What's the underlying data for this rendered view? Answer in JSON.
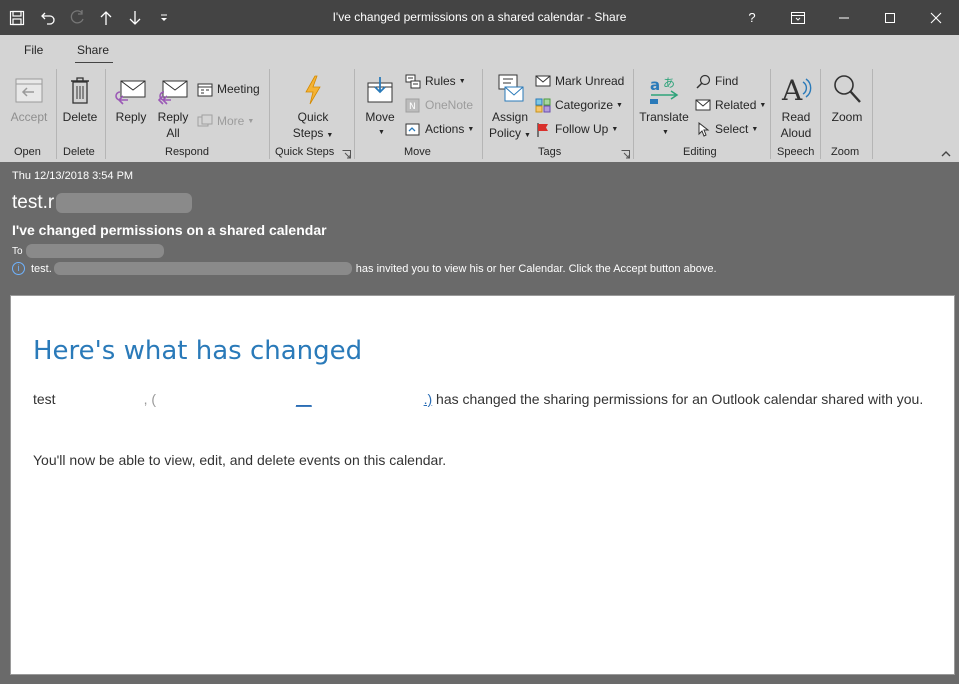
{
  "window": {
    "title": "I've changed permissions on a shared calendar  -  Share",
    "help": "?"
  },
  "tabs": [
    {
      "label": "File"
    },
    {
      "label": "Share"
    }
  ],
  "ribbon": {
    "open": {
      "accept": "Accept",
      "group": "Open"
    },
    "delete": {
      "delete": "Delete",
      "group": "Delete"
    },
    "respond": {
      "reply": "Reply",
      "reply_all_1": "Reply",
      "reply_all_2": "All",
      "meeting": "Meeting",
      "more": "More",
      "group": "Respond"
    },
    "quick_steps": {
      "label_1": "Quick",
      "label_2": "Steps",
      "group": "Quick Steps"
    },
    "move": {
      "move": "Move",
      "rules": "Rules",
      "onenote": "OneNote",
      "actions": "Actions",
      "group": "Move"
    },
    "tags": {
      "assign_1": "Assign",
      "assign_2": "Policy",
      "mark_unread": "Mark Unread",
      "categorize": "Categorize",
      "follow_up": "Follow Up",
      "group": "Tags"
    },
    "editing": {
      "translate": "Translate",
      "find": "Find",
      "related": "Related",
      "select": "Select",
      "group": "Editing"
    },
    "speech": {
      "read_1": "Read",
      "read_2": "Aloud",
      "group": "Speech"
    },
    "zoom": {
      "zoom": "Zoom",
      "group": "Zoom"
    }
  },
  "message": {
    "date": "Thu 12/13/2018 3:54 PM",
    "sender_prefix": "test.r",
    "subject": "I've changed permissions on a shared calendar",
    "to_label": "To",
    "info_prefix": "test.",
    "info_text": "has invited you to view his or her Calendar.  Click the Accept button above."
  },
  "body": {
    "headline": "Here's what has changed",
    "para1_start": "test",
    "para1_frag1": ", (",
    "para1_frag2": "__",
    "para1_frag3": ".)",
    "para1_end": " has changed the sharing permissions for an Outlook calendar shared with you.",
    "para2": "You'll now be able to view, edit, and delete events on this calendar."
  },
  "colors": {
    "titlebar": "#444444",
    "ribbon": "#d4d4d4",
    "header": "#6a6a6a",
    "headline": "#2a7ab9"
  }
}
